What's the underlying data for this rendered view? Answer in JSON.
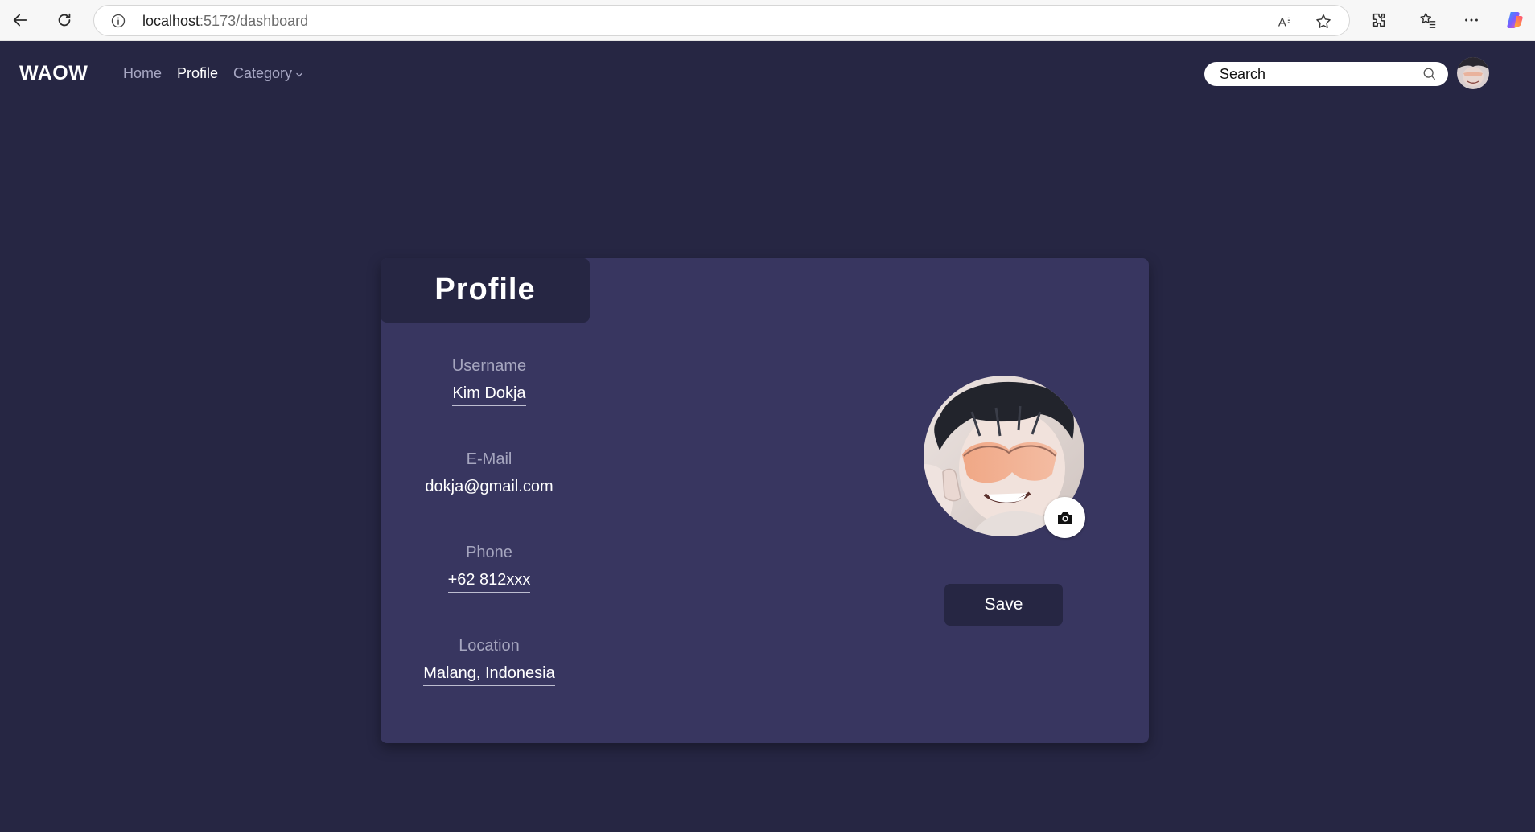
{
  "browser": {
    "url_host": "localhost",
    "url_path": ":5173/dashboard",
    "icons": [
      "back-arrow-icon",
      "refresh-icon",
      "site-info-icon",
      "read-aloud-icon",
      "favorite-star-icon",
      "extensions-icon",
      "favorites-icon",
      "more-icon",
      "copilot-icon"
    ]
  },
  "nav": {
    "logo": "WAOW",
    "links": [
      {
        "label": "Home"
      },
      {
        "label": "Profile"
      },
      {
        "label": "Category"
      }
    ],
    "search_placeholder": "Search"
  },
  "profile": {
    "title": "Profile",
    "fields": [
      {
        "label": "Username",
        "value": "Kim Dokja"
      },
      {
        "label": "E-Mail",
        "value": "dokja@gmail.com"
      },
      {
        "label": "Phone",
        "value": "+62 812xxx"
      },
      {
        "label": "Location",
        "value": "Malang, Indonesia"
      }
    ],
    "save_label": "Save"
  },
  "colors": {
    "page_bg": "#262643",
    "card_bg": "#383660",
    "muted_text": "#a6a6bf",
    "text": "#ffffff"
  }
}
